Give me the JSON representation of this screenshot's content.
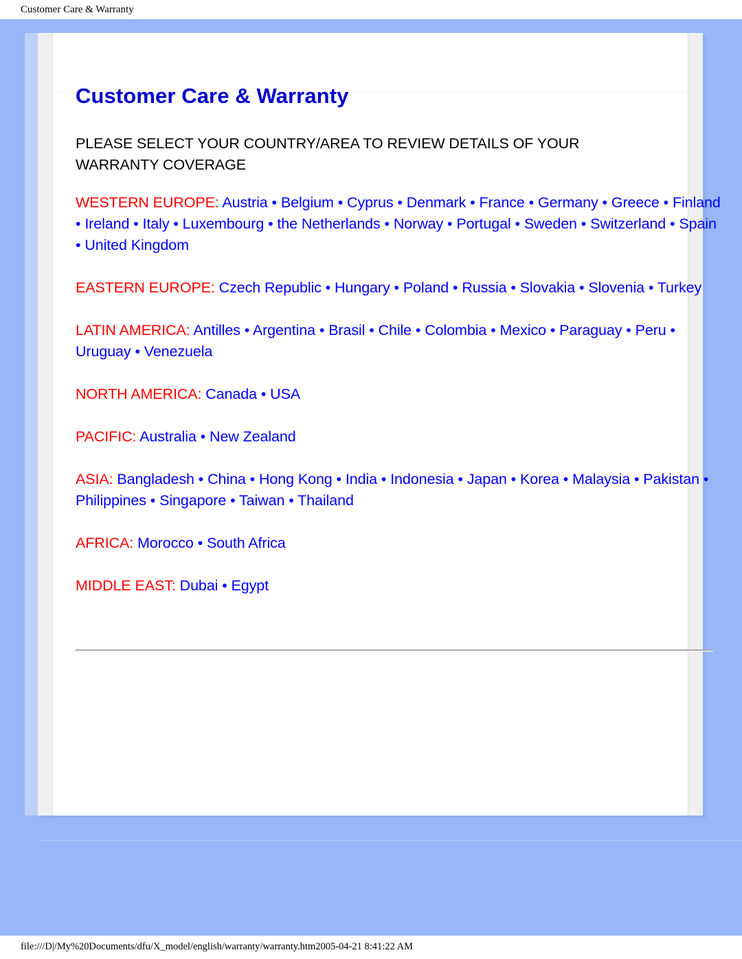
{
  "browser": {
    "print_header": "Customer Care & Warranty",
    "footer_path": "file:///D|/My%20Documents/dfu/X_model/english/warranty/warranty.htm2005-04-21 8:41:22 AM"
  },
  "colors": {
    "page_background": "#97b7fa",
    "paper": "#ffffff",
    "gutter": "#efefef",
    "title": "#0000cc",
    "region_label": "#ff0000",
    "link": "#0000ff",
    "body_text": "#000000",
    "divider": "#a9a9a9"
  },
  "page": {
    "title": "Customer Care & Warranty",
    "subtitle": "PLEASE SELECT YOUR COUNTRY/AREA TO REVIEW DETAILS OF YOUR WARRANTY COVERAGE",
    "separator": "•"
  },
  "regions": [
    {
      "label": "WESTERN EUROPE:",
      "countries": [
        "Austria",
        "Belgium",
        "Cyprus",
        "Denmark",
        "France",
        "Germany",
        "Greece",
        "Finland",
        "Ireland",
        "Italy",
        "Luxembourg",
        "the Netherlands",
        "Norway",
        "Portugal",
        "Sweden",
        "Switzerland",
        "Spain",
        "United Kingdom"
      ]
    },
    {
      "label": "EASTERN EUROPE:",
      "countries": [
        "Czech Republic",
        "Hungary",
        "Poland",
        "Russia",
        "Slovakia",
        "Slovenia",
        "Turkey"
      ]
    },
    {
      "label": "LATIN AMERICA:",
      "countries": [
        "Antilles",
        "Argentina",
        "Brasil",
        "Chile",
        "Colombia",
        "Mexico",
        "Paraguay",
        "Peru",
        "Uruguay",
        "Venezuela"
      ]
    },
    {
      "label": "NORTH AMERICA:",
      "countries": [
        "Canada",
        "USA"
      ]
    },
    {
      "label": "PACIFIC:",
      "countries": [
        "Australia",
        "New Zealand"
      ]
    },
    {
      "label": "ASIA:",
      "countries": [
        "Bangladesh",
        "China",
        "Hong Kong",
        "India",
        "Indonesia",
        "Japan",
        "Korea",
        "Malaysia",
        "Pakistan",
        "Philippines",
        "Singapore",
        "Taiwan",
        "Thailand"
      ]
    },
    {
      "label": "AFRICA:",
      "countries": [
        "Morocco",
        "South Africa"
      ]
    },
    {
      "label": "MIDDLE EAST:",
      "countries": [
        "Dubai",
        "Egypt"
      ]
    }
  ]
}
